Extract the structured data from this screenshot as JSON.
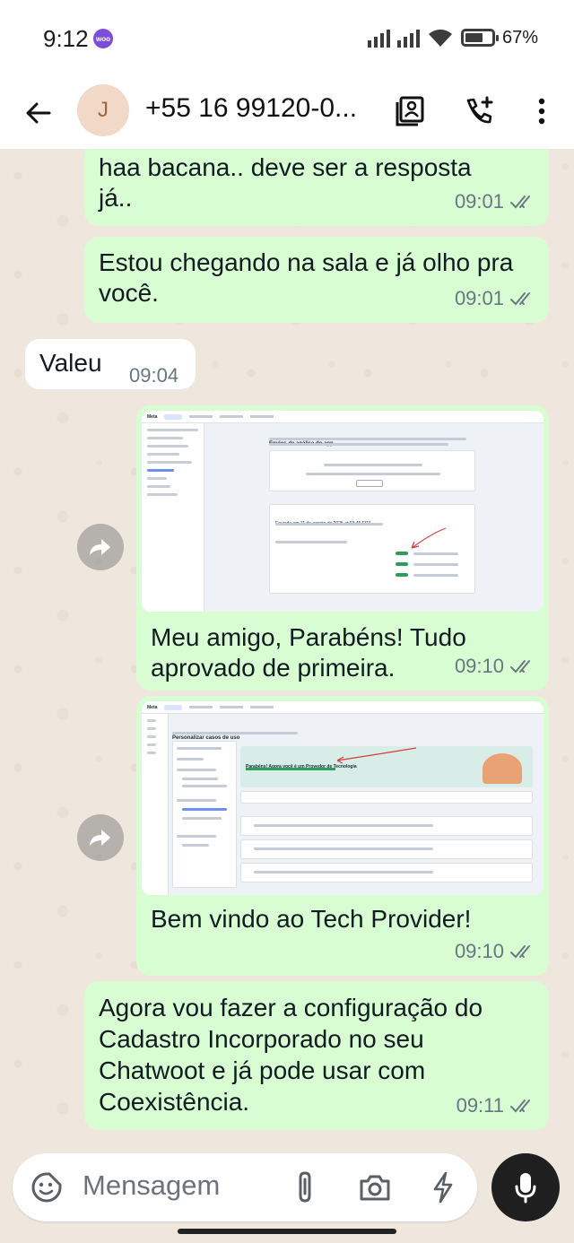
{
  "status_bar": {
    "time": "9:12",
    "app_badge": "woo",
    "battery": "67%",
    "battery_level": 0.67
  },
  "header": {
    "avatar_initial": "J",
    "contact": "+55 16 99120-0..."
  },
  "messages": [
    {
      "text": "haa bacana.. deve ser a resposta já..",
      "time": "09:01"
    },
    {
      "text": "Estou chegando na sala e já olho pra você.",
      "time": "09:01"
    },
    {
      "text": "Valeu",
      "time": "09:04"
    },
    {
      "caption": "Meu amigo, Parabéns! Tudo aprovado de primeira.",
      "time": "09:10",
      "image": {
        "brand": "Meta",
        "title": "Envios de análise do app",
        "section": "Envios anteriores",
        "subtitle": "Enviado em 11 de agosto de 2025 at 03:45 ERT"
      }
    },
    {
      "caption": "Bem vindo ao Tech Provider!",
      "time": "09:10",
      "image": {
        "brand": "Meta",
        "title": "Personalizar casos de uso",
        "banner": "Parabéns! Agora você é um Provedor de Tecnologia",
        "section": "Ofereça mais aos seus clientes"
      }
    },
    {
      "text": "Agora vou fazer a configuração do Cadastro Incorporado no seu Chatwoot e já pode usar com Coexistência.",
      "time": "09:11"
    }
  ],
  "composer": {
    "placeholder": "Mensagem"
  },
  "colors": {
    "outgoing": "#d9fdd3",
    "incoming": "#ffffff",
    "wallpaper": "#efe7de",
    "ticks": "#6b7880"
  }
}
